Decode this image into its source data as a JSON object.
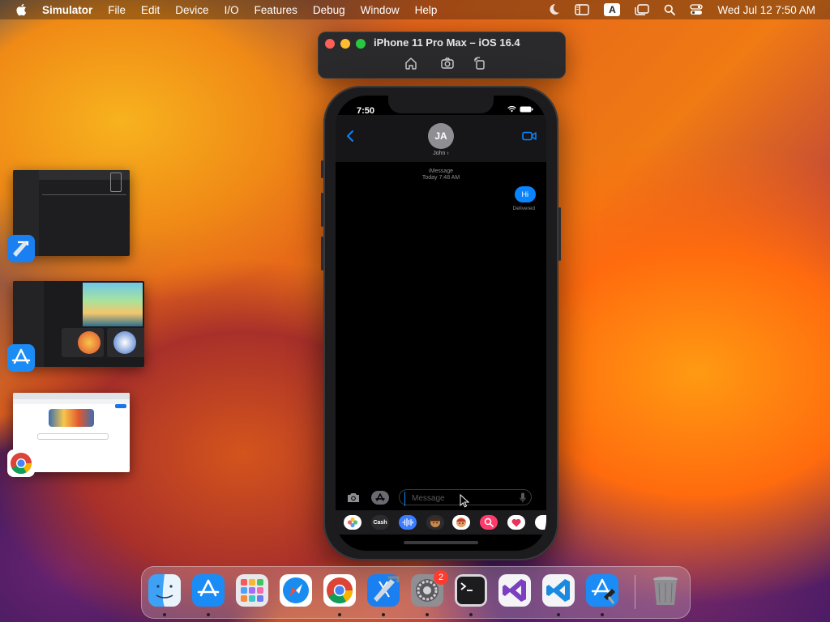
{
  "menubar": {
    "app_name": "Simulator",
    "items": [
      "File",
      "Edit",
      "Device",
      "I/O",
      "Features",
      "Debug",
      "Window",
      "Help"
    ],
    "keyboard_input": "A",
    "clock": "Wed Jul 12  7:50 AM"
  },
  "simulator": {
    "title": "iPhone 11 Pro Max – iOS 16.4"
  },
  "phone": {
    "status_time": "7:50",
    "contact_initials": "JA",
    "contact_name": "John ›",
    "service_label": "iMessage",
    "timestamp": "Today 7:48 AM",
    "messages": [
      {
        "text": "Hi",
        "direction": "outgoing",
        "status": "Delivered"
      }
    ],
    "input_placeholder": "Message",
    "strip_apps": [
      "photos",
      "cash",
      "audio",
      "memoji",
      "stickers",
      "images",
      "fitness",
      "more"
    ],
    "cash_label": "Cash"
  },
  "dock": {
    "apps": [
      "Finder",
      "App Store",
      "Launchpad",
      "Safari",
      "Chrome",
      "Xcode",
      "System Settings",
      "Terminal",
      "Visual Studio",
      "Visual Studio Code",
      "Xcode Tools",
      "Trash"
    ],
    "settings_badge": "2"
  },
  "colors": {
    "imessage_blue": "#0a84ff",
    "badge_red": "#ff3b30"
  }
}
